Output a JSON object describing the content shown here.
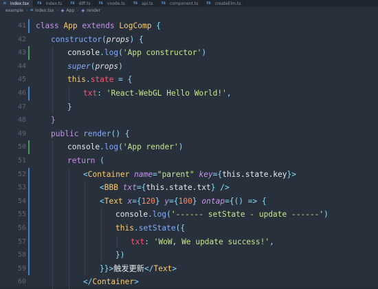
{
  "tabs": [
    {
      "label": "index.tsx",
      "icon": "tsx",
      "active": true
    },
    {
      "label": "index.ts",
      "icon": "TS",
      "active": false
    },
    {
      "label": "diff.ts",
      "icon": "TS",
      "active": false
    },
    {
      "label": "vnode.ts",
      "icon": "TS",
      "active": false
    },
    {
      "label": "api.ts",
      "icon": "TS",
      "active": false
    },
    {
      "label": "component.ts",
      "icon": "TS",
      "active": false
    },
    {
      "label": "createElm.ts",
      "icon": "TS",
      "active": false
    }
  ],
  "breadcrumb": {
    "folder": "example",
    "file": "index.tsx",
    "class": "App",
    "method": "render"
  },
  "lines": [
    {
      "n": "41"
    },
    {
      "n": "42"
    },
    {
      "n": "43"
    },
    {
      "n": "44"
    },
    {
      "n": "45"
    },
    {
      "n": "46"
    },
    {
      "n": "47"
    },
    {
      "n": "48"
    },
    {
      "n": "49"
    },
    {
      "n": "50"
    },
    {
      "n": "51"
    },
    {
      "n": "52"
    },
    {
      "n": "53"
    },
    {
      "n": "54"
    },
    {
      "n": "55"
    },
    {
      "n": "56"
    },
    {
      "n": "57"
    },
    {
      "n": "58"
    },
    {
      "n": "59"
    },
    {
      "n": "60"
    }
  ],
  "code": {
    "l41": {
      "kw1": "class",
      "name": "App",
      "kw2": "extends",
      "base": "LogComp",
      "brace": "{"
    },
    "l42": {
      "fn": "constructor",
      "param": "props"
    },
    "l43": {
      "obj": "console",
      "fn": "log",
      "str": "'App constructor'"
    },
    "l44": {
      "fn": "super",
      "param": "props"
    },
    "l45": {
      "kw": "this",
      "prop": "state",
      "op": "=",
      "brace": "{"
    },
    "l46": {
      "key": "txt",
      "str": "'React-WebGL Hello World!'"
    },
    "l47": {
      "brace": "}"
    },
    "l48": {
      "brace": "}"
    },
    "l49": {
      "kw": "public",
      "fn": "render",
      "brace": "{"
    },
    "l50": {
      "obj": "console",
      "fn": "log",
      "str": "'App render'"
    },
    "l51": {
      "kw": "return"
    },
    "l52": {
      "tag": "Container",
      "a1": "name",
      "v1": "\"parent\"",
      "a2": "key",
      "v2": "this.state.key"
    },
    "l53": {
      "tag": "BBB",
      "a1": "txt",
      "v1": "this.state.txt"
    },
    "l54": {
      "tag": "Text",
      "a1": "x",
      "v1": "120",
      "a2": "y",
      "v2": "100",
      "a3": "ontap"
    },
    "l55": {
      "obj": "console",
      "fn": "log",
      "str": "'------ setState - update ------'"
    },
    "l56": {
      "kw": "this",
      "fn": "setState"
    },
    "l57": {
      "key": "txt",
      "str": "'WoW, We update success!'"
    },
    "l58": {
      "close": "})"
    },
    "l59": {
      "text": "触发更新",
      "tag": "Text"
    },
    "l60": {
      "tag": "Container"
    }
  },
  "colors": {
    "background": "#27303b",
    "tabbar": "#1f262f",
    "gutter_modified_green": "#4c9a5b",
    "gutter_modified_blue": "#3f7fc4"
  }
}
